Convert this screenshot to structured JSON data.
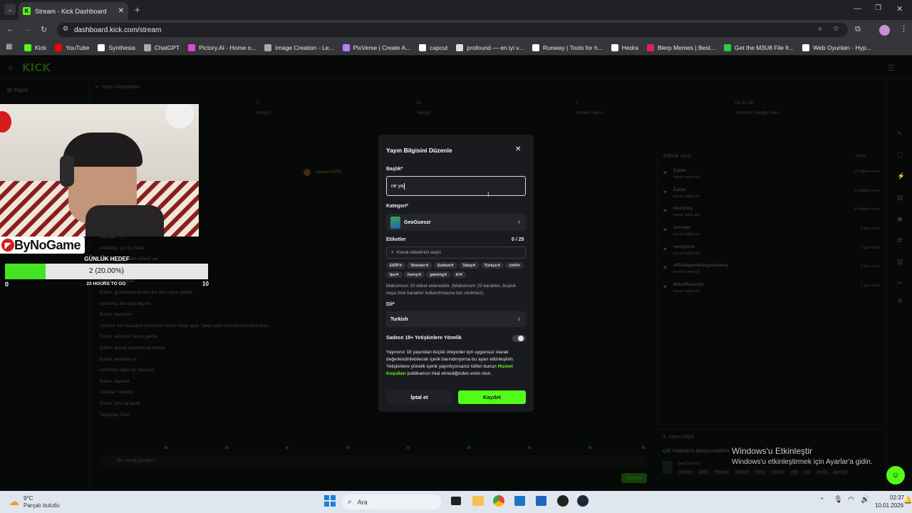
{
  "browser": {
    "tab_title": "Stream - Kick Dashboard",
    "url": "dashboard.kick.com/stream",
    "bookmarks": [
      "Kick",
      "YouTube",
      "Synthesia",
      "ChatGPT",
      "Pictory.AI - Home o...",
      "Image Creation - Le...",
      "PixVerse | Create A...",
      "capcut",
      "profound — en iyi v...",
      "Runway | Tools for h...",
      "Hedra",
      "Blerp Memes | Best...",
      "Get the M3U8 File fr...",
      "Web Oyunları - Hyp..."
    ],
    "bookmark_colors": [
      "#53fc18",
      "#ff0000",
      "#ffffff",
      "#aaaaaa",
      "#e04ad0",
      "#aaaaaa",
      "#b97cff",
      "#ffffff",
      "#dddddd",
      "#ffffff",
      "#ffffff",
      "#e0205c",
      "#2ecc40",
      "#ffffff"
    ]
  },
  "dashboard": {
    "logo": "KICK",
    "sidebar_item": "Yayın",
    "stats_header": "Yayın İstatistikleri",
    "stats": [
      {
        "value": "9",
        "label": "İzleyici"
      },
      {
        "value": "52",
        "label": "Takipçi"
      },
      {
        "value": "1",
        "label": "Abone Sayısı"
      },
      {
        "value": "02:31:56",
        "label": "Yayında Olduğu Süre"
      }
    ],
    "chat_user": "cavess1905",
    "chat_lines": [
      "Danişar: +1",
      "meliihxq: çok bu farklı",
      "Danişar: bu direkt sürekli var",
      "Eafair: istinam bence",
      "Eafair: yada irdin",
      "Eafair: guatemala kosta rika tarzı biyer galiba",
      "meliihxq: bari boş akyom",
      "Eafair: bulamını",
      "Lisatoz: İlet masajları yüzünden takip modu açık. Takip edip sohbete katılabilirsiniz.",
      "Eafair: ekvador fason galiba",
      "Eafair: güney amerika ait bence",
      "Eafair: ekvador vs",
      "meliihxq: diğer tur basıcam",
      "Eafair: tayland",
      "Danişar: tayland",
      "Eafair: şimi ait tarafı",
      "Takipçiye Özel"
    ],
    "chat_input_placeholder": "Bir mesaj gönderin",
    "send_label": "Gönder",
    "activity_header": "Etkinlik Akışı",
    "filter_label": "Filtre",
    "activity": [
      {
        "user": "Eafair",
        "sub": "kanalı takip etti",
        "time": "16 dakika önce"
      },
      {
        "user": "Eafair",
        "sub": "kanalı takip etti",
        "time": "16 dakika önce"
      },
      {
        "user": "meliihxq",
        "sub": "kanalı takip etti",
        "time": "53 dakika önce"
      },
      {
        "user": "xorcees",
        "sub": "kanalı takip etti",
        "time": "1 gün önce"
      },
      {
        "user": "verdiyeva",
        "sub": "kanalı takip etti",
        "time": "1 gün önce"
      },
      {
        "user": "officialgamblingacademy",
        "sub": "kanalı takip etti",
        "time": "1 gün önce"
      },
      {
        "user": "MikePhantom",
        "sub": "kanalı takip etti",
        "time": "1 gün önce"
      }
    ],
    "stream_info_header": "Yayın bilgisi",
    "stream_info_title": "ÇİĞ YUMURTA İDDALI HARİTA",
    "stream_info_category": "GeoGuessr",
    "stream_info_tags": [
      "Turkish",
      "EKİP",
      "Shooter",
      "Sohbet",
      "Takip",
      "Türkçe",
      "chill",
      "fps",
      "funny",
      "gaming"
    ]
  },
  "overlay": {
    "brand": "ByNoGame",
    "goal_title": "GÜNLÜK HEDEF",
    "goal_value": "2 (20.00%)",
    "goal_progress": 0.2,
    "goal_min": "0",
    "goal_max": "10",
    "goal_remaining": "23 HOURS TO GO"
  },
  "modal": {
    "title": "Yayın Bilgisini Düzenle",
    "title_label": "Başlık*",
    "title_value": "ne ya",
    "category_label": "Kategori*",
    "category_value": "GeoGuessr",
    "tags_label": "Etiketler",
    "tags_count": "0 / 25",
    "tags_placeholder": "Kendi etiketinizi seçin",
    "tags": [
      "EKİP",
      "Shooter",
      "Sohbet",
      "Takip",
      "Türkçe",
      "chill",
      "fps",
      "funny",
      "gaming",
      "irl"
    ],
    "tags_hint": "Maksimum 10 etiket eklenebilir. (Maksimum 25 karakter, boşluk veya özel karakter kullanılmasına izin verilmez).",
    "language_label": "Dil*",
    "language_value": "Turkish",
    "adult_label": "Sadece 18+ Yetişkinlere Yönelik",
    "adult_text_1": "Yayınınız 18 yaşından küçük izleyiciler için uygunsuz olarak değerlendirilebilecek içerik barındırıyorsa bu ayarı etkinleştirin. Yetişkinlere yönelik içerik yayınlıyorsanız lütfen bunun ",
    "adult_link": "Hizmet Koşulları",
    "adult_text_2": " politikamızı ihlal etmediğinden emin olun.",
    "cancel_label": "İptal et",
    "save_label": "Kaydet"
  },
  "windows": {
    "activate_title": "Windows'u Etkinleştir",
    "activate_sub": "Windows'u etkinleştirmek için Ayarlar'a gidin.",
    "weather_temp": "9°C",
    "weather_desc": "Parçalı bulutlu",
    "search_label": "Ara",
    "time": "02:37",
    "date": "10.01.2026"
  }
}
